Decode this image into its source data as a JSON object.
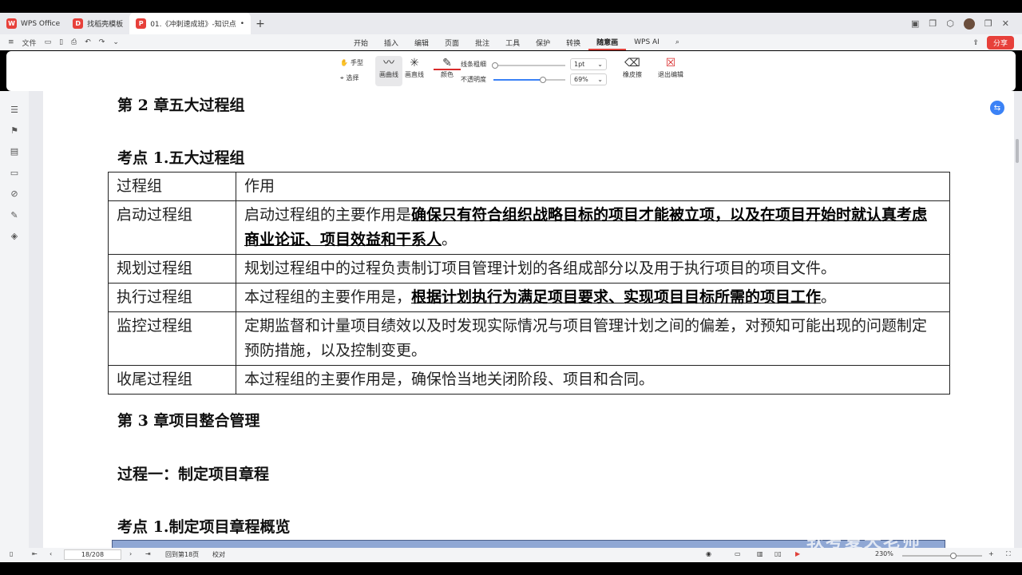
{
  "tabs": [
    {
      "label": "WPS Office"
    },
    {
      "label": "找稻壳模板"
    },
    {
      "label": "01.《冲刺速成班》-知识点"
    }
  ],
  "menu": {
    "file": "文件",
    "tabs": [
      "开始",
      "插入",
      "编辑",
      "页面",
      "批注",
      "工具",
      "保护",
      "转换",
      "随意画",
      "WPS AI"
    ],
    "active_tab": "随意画",
    "share": "分享"
  },
  "ribbon": {
    "hand": "手型",
    "select": "选择",
    "curve": "画曲线",
    "line": "画直线",
    "color": "颜色",
    "thickness_label": "线条粗细",
    "opacity_label": "不透明度",
    "thickness_value": "1pt",
    "opacity_value": "69%",
    "opacity_level": 0.69,
    "eraser": "橡皮擦",
    "exit": "退出编辑",
    "pen_color": "#d92b2b"
  },
  "document": {
    "chapter2": "第 2 章五大过程组",
    "kp1": "考点 1.五大过程组",
    "table": {
      "headers": [
        "过程组",
        "作用"
      ],
      "rows": [
        {
          "name": "启动过程组",
          "pre": "启动过程组的主要作用是",
          "bold": "确保只有符合组织战略目标的项目才能被立项，以及在项目开始时就认真考虑商业论证、项目效益和干系人",
          "post": "。"
        },
        {
          "name": "规划过程组",
          "pre": "规划过程组中的过程负责制订项目管理计划的各组成部分以及用于执行项目的项目文件。",
          "bold": "",
          "post": ""
        },
        {
          "name": "执行过程组",
          "pre": "本过程组的主要作用是，",
          "bold": "根据计划执行为满足项目要求、实现项目目标所需的项目工作",
          "post": "。"
        },
        {
          "name": "监控过程组",
          "pre": "定期监督和计量项目绩效以及时发现实际情况与项目管理计划之间的偏差，对预知可能出现的问题制定预防措施，以及控制变更。",
          "bold": "",
          "post": ""
        },
        {
          "name": "收尾过程组",
          "pre": "本过程组的主要作用是，确保恰当地关闭阶段、项目和合同。",
          "bold": "",
          "post": ""
        }
      ]
    },
    "chapter3": "第 3 章项目整合管理",
    "process1": "过程一：制定项目章程",
    "kp1b": "考点 1.制定项目章程概览"
  },
  "status": {
    "page": "18/208",
    "back": "回到第18页",
    "proof": "校对",
    "zoom": "230%"
  },
  "watermark": "软考夏天老师"
}
